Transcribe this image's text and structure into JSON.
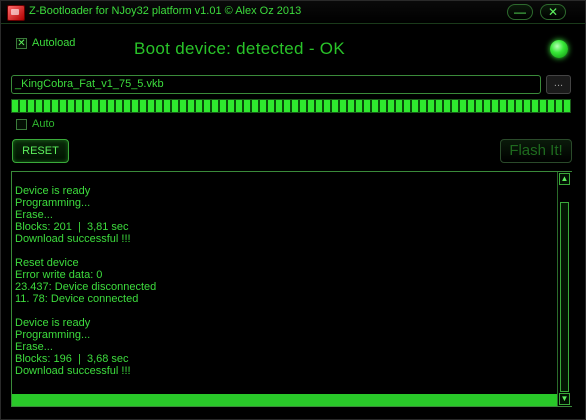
{
  "window": {
    "title": "Z-Bootloader for NJoy32 platform v1.01 © Alex Oz 2013",
    "minimize_label": "—",
    "close_label": "✕"
  },
  "autoload": {
    "label": "Autoload",
    "checked": true,
    "check_mark": "✕"
  },
  "status": {
    "text": "Boot device: detected - OK",
    "led_color": "#3ef03e"
  },
  "file": {
    "value": "_KingCobra_Fat_v1_75_5.vkb",
    "browse_label": "..."
  },
  "progress": {
    "percent": 100
  },
  "auto": {
    "label": "Auto",
    "checked": false
  },
  "buttons": {
    "reset_label": "RESET",
    "flash_label": "Flash It!"
  },
  "log": {
    "lines": [
      "Device is ready",
      "Programming...",
      "Erase...",
      "Blocks: 201  |  3,81 sec",
      "Download successful !!!",
      "",
      "Reset device",
      "Error write data: 0",
      "23.437: Device disconnected",
      "11. 78: Device connected",
      "",
      "Device is ready",
      "Programming...",
      "Erase...",
      "Blocks: 196  |  3,68 sec",
      "Download successful !!!"
    ],
    "scroll_up_label": "▲",
    "scroll_down_label": "▼"
  }
}
